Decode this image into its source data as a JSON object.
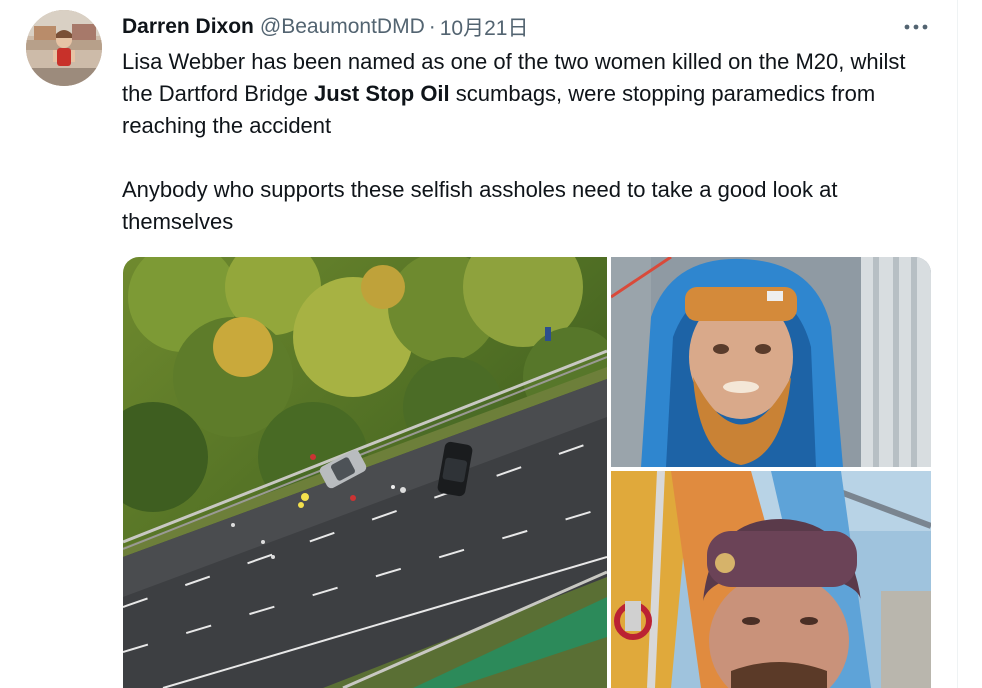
{
  "tweet": {
    "author_name": "Darren Dixon",
    "author_handle": "@BeaumontDMD",
    "separator": "·",
    "date": "10月21日",
    "more_icon": "ellipsis-icon",
    "text": {
      "line1_a": "Lisa Webber has been named as one of the two women killed on the M20, whilst the Dartford Bridge ",
      "line1_bold": "Just Stop Oil",
      "line1_b": " scumbags, were stopping paramedics from reaching the accident",
      "paragraph2": "Anybody who supports these selfish assholes need to take a good look at themselves"
    }
  },
  "media": {
    "photos": [
      {
        "subject": "aerial view of motorway crash scene"
      },
      {
        "subject": "bearded protester in blue hood on bridge"
      },
      {
        "subject": "protester in knit hat in hammock on bridge"
      }
    ]
  },
  "colors": {
    "text_primary": "#0f1419",
    "text_secondary": "#536471",
    "border": "#eff3f4"
  }
}
